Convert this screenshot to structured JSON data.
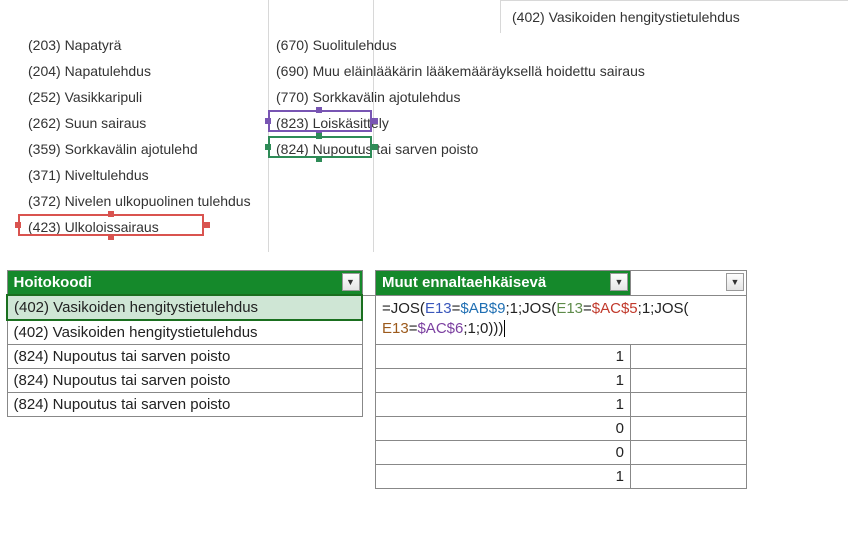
{
  "top": {
    "colA": [
      {
        "text": "(203) Napatyrä"
      },
      {
        "text": "(204) Napatulehdus"
      },
      {
        "text": "(252) Vasikkaripuli"
      },
      {
        "text": "(262) Suun sairaus"
      },
      {
        "text": "(359) Sorkkavälin ajotulehd"
      },
      {
        "text": "(371) Niveltulehdus"
      },
      {
        "text": "(372) Nivelen ulkopuolinen tulehdus"
      },
      {
        "text": "(423) Ulkoloissairaus"
      }
    ],
    "colB": [
      {
        "text": "(670) Suolitulehdus"
      },
      {
        "text": "(690) Muu eläinlääkärin lääkemääräyksellä hoidettu sairaus"
      },
      {
        "text": "(770) Sorkkavälin ajotulehdus"
      },
      {
        "text": "(823) Loiskäsittely"
      },
      {
        "text": "(824) Nupoutus tai sarven poisto"
      }
    ],
    "topRight": "(402) Vasikoiden hengitystietulehdus"
  },
  "table": {
    "headers": {
      "code": "Hoitokoodi",
      "group": "Muut ennaltaehkäisevä"
    },
    "formula": {
      "prefix": "=JOS(",
      "e1": "E13",
      "eq": "=",
      "r1": "$AB$9",
      "s1": ";1;JOS(",
      "e2": "E13",
      "r2": "$AC$5",
      "s2": ";1;JOS(",
      "e3": "E13",
      "r3": "$AC$6",
      "end": ";1;0)))"
    },
    "rows": [
      {
        "code": "(402) Vasikoiden hengitystietulehdus",
        "val": ""
      },
      {
        "code": "(402) Vasikoiden hengitystietulehdus",
        "val": ""
      },
      {
        "code": "(824) Nupoutus tai sarven poisto",
        "val": "1"
      },
      {
        "code": "(824) Nupoutus tai sarven poisto",
        "val": "1"
      },
      {
        "code": "(824) Nupoutus tai sarven poisto",
        "val": "1"
      },
      {
        "code": "",
        "val": "0"
      },
      {
        "code": "",
        "val": "0"
      },
      {
        "code": "",
        "val": "1"
      }
    ]
  },
  "icons": {
    "dropdown": "▼"
  }
}
